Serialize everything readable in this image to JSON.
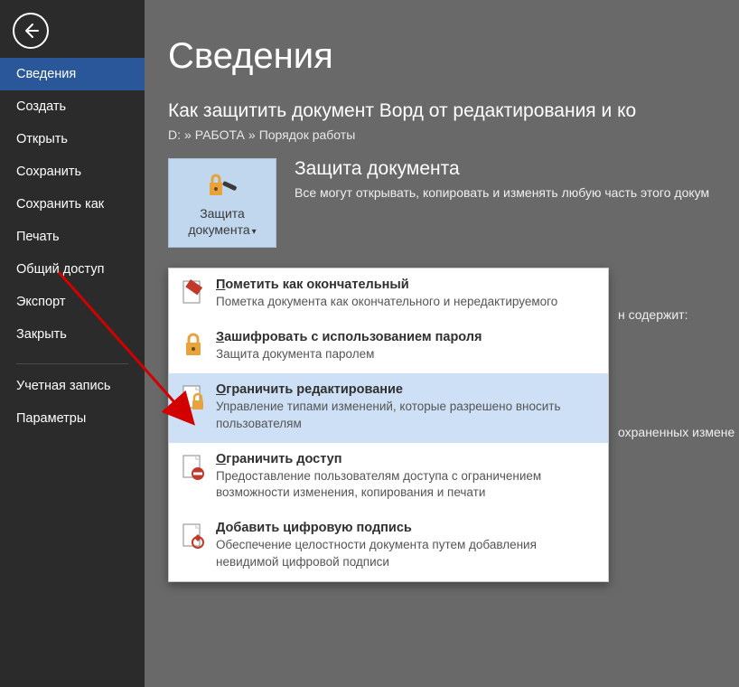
{
  "sidebar": {
    "items": [
      {
        "label": "Сведения",
        "active": true
      },
      {
        "label": "Создать"
      },
      {
        "label": "Открыть"
      },
      {
        "label": "Сохранить"
      },
      {
        "label": "Сохранить как"
      },
      {
        "label": "Печать"
      },
      {
        "label": "Общий доступ"
      },
      {
        "label": "Экспорт"
      },
      {
        "label": "Закрыть"
      }
    ],
    "footer": [
      {
        "label": "Учетная запись"
      },
      {
        "label": "Параметры"
      }
    ]
  },
  "page": {
    "title": "Сведения",
    "doc_title": "Как защитить документ Ворд от редактирования и ко",
    "breadcrumb": [
      "D:",
      "РАБОТА",
      "Порядок работы"
    ]
  },
  "protect": {
    "button_label": "Защита документа",
    "heading": "Защита документа",
    "description": "Все могут открывать, копировать и изменять любую часть этого докум"
  },
  "bg_fragments": {
    "a": "н содержит:",
    "b": "охраненных измене"
  },
  "dropdown": {
    "items": [
      {
        "title_underline": "П",
        "title_rest": "ометить как окончательный",
        "desc": "Пометка документа как окончательного и нередактируемого"
      },
      {
        "title_underline": "З",
        "title_rest": "ашифровать с использованием пароля",
        "desc": "Защита документа паролем"
      },
      {
        "title_underline": "О",
        "title_rest": "граничить редактирование",
        "desc": "Управление типами изменений, которые разрешено вносить пользователям",
        "highlight": true
      },
      {
        "title_underline": "О",
        "title_rest": "граничить доступ",
        "desc": "Предоставление пользователям доступа с ограничением возможности изменения, копирования и печати"
      },
      {
        "title_underline": "Д",
        "title_rest": "обавить цифровую подпись",
        "desc": "Обеспечение целостности документа путем добавления невидимой цифровой подписи"
      }
    ]
  }
}
